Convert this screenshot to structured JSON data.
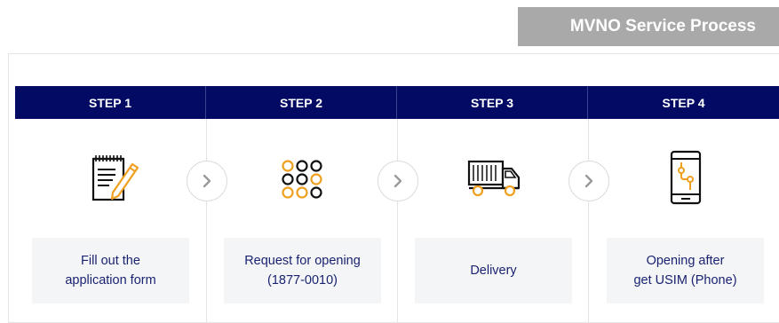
{
  "title": "MVNO Service Process",
  "steps": [
    {
      "label": "STEP 1",
      "icon": "application-form-icon",
      "lines": [
        "Fill out the",
        "application form"
      ]
    },
    {
      "label": "STEP 2",
      "icon": "keypad-icon",
      "lines": [
        "Request for opening",
        "(1877-0010)"
      ]
    },
    {
      "label": "STEP 3",
      "icon": "delivery-truck-icon",
      "lines": [
        "Delivery"
      ]
    },
    {
      "label": "STEP 4",
      "icon": "phone-usim-icon",
      "lines": [
        "Opening after",
        "get USIM (Phone)"
      ]
    }
  ],
  "colors": {
    "header_bg": "#020a63",
    "accent": "#f0a020",
    "badge_bg": "#a9a9a9",
    "desc_bg": "#f4f5f7",
    "desc_text": "#1a2370"
  }
}
